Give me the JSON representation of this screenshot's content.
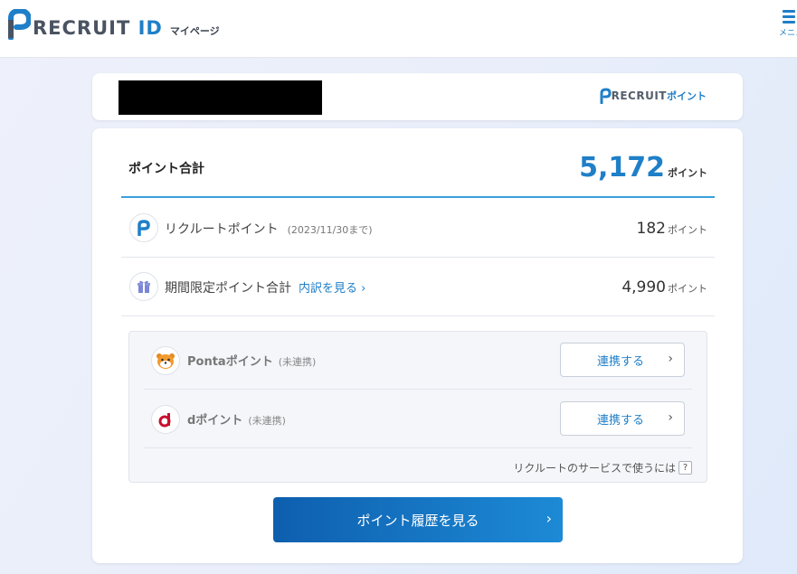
{
  "header": {
    "logo_text": "RECRUIT",
    "logo_text_id": "ID",
    "logo_sub": "マイページ",
    "menu_label": "メニュー"
  },
  "brand": {
    "logo_text": "RECRUIT",
    "logo_suffix": "ポイント"
  },
  "total": {
    "label": "ポイント合計",
    "value": "5,172",
    "unit": "ポイント"
  },
  "points": [
    {
      "name": "リクルートポイント",
      "note": "(2023/11/30まで)",
      "value": "182",
      "unit": "ポイント",
      "icon": "recruit-p-icon"
    },
    {
      "name": "期間限定ポイント合計",
      "link": "内訳を見る",
      "value": "4,990",
      "unit": "ポイント",
      "icon": "gift-icon"
    }
  ],
  "linked": [
    {
      "name": "Pontaポイント",
      "status": "(未連携)",
      "button": "連携する",
      "icon": "ponta-icon"
    },
    {
      "name": "dポイント",
      "status": "(未連携)",
      "button": "連携する",
      "icon": "d-point-icon"
    }
  ],
  "help_text": "リクルートのサービスで使うには",
  "help_icon": "?",
  "history_button": "ポイント履歴を見る",
  "colors": {
    "accent": "#1f7fc8",
    "divider": "#3aa0dc"
  }
}
